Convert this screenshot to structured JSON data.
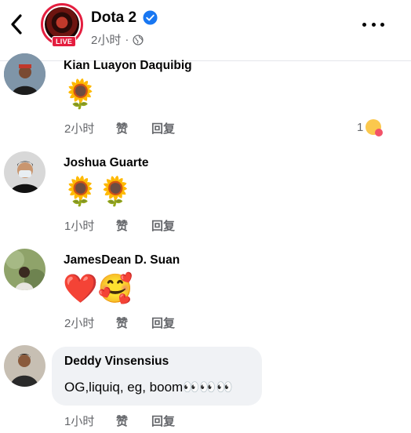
{
  "header": {
    "page_name": "Dota 2",
    "time": "2小时",
    "separator": "·",
    "live_label": "LIVE"
  },
  "comments": [
    {
      "author": "Kian Luayon Daquibig",
      "body": "🌻",
      "time": "2小时",
      "like": "赞",
      "reply": "回复",
      "reaction_count": "1"
    },
    {
      "author": "Joshua Guarte",
      "body": "🌻🌻",
      "time": "1小时",
      "like": "赞",
      "reply": "回复"
    },
    {
      "author": "JamesDean D. Suan",
      "body": "❤️🥰",
      "time": "2小时",
      "like": "赞",
      "reply": "回复"
    },
    {
      "author": "Deddy Vinsensius",
      "body": "OG,liquiq, eg, boom👀👀👀",
      "time": "1小时",
      "like": "赞",
      "reply": "回复"
    }
  ],
  "colors": {
    "live_red": "#e41e3f",
    "verified_blue": "#1877f2",
    "secondary_text": "#65676b",
    "bubble_bg": "#f0f2f5"
  }
}
